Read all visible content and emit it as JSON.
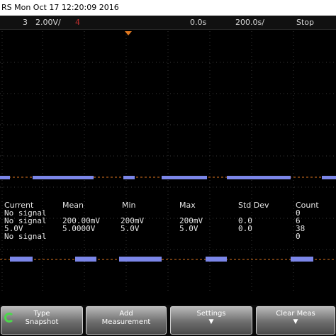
{
  "titlebar": {
    "text": "RS Mon Oct 17 12:20:09 2016"
  },
  "status": {
    "channel": "3",
    "volts_div": "2.00V/",
    "channel4": "4",
    "time_pos": "0.0s",
    "time_div": "200.0s/",
    "run_state": "Stop"
  },
  "colors": {
    "trace": "#7b86e8",
    "grid": "#3a3a3a",
    "trigger": "#e07820",
    "active_icon": "#4bd84b"
  },
  "measurements": {
    "headers": [
      "Current",
      "Mean",
      "Min",
      "Max",
      "Std Dev",
      "Count"
    ],
    "rows": [
      [
        "No signal",
        "",
        "",
        "",
        "",
        "0"
      ],
      [
        "No signal",
        "200.00mV",
        "200mV",
        "200mV",
        "0.0",
        "6"
      ],
      [
        "5.0V",
        "5.0000V",
        "5.0V",
        "5.0V",
        "0.0",
        "38"
      ],
      [
        "No signal",
        "",
        "",
        "",
        "",
        "0"
      ]
    ]
  },
  "softkeys": [
    {
      "line1": "Type",
      "line2": "Snapshot",
      "icon": "cycle-icon"
    },
    {
      "line1": "Add",
      "line2": "Measurement"
    },
    {
      "line1": "Settings",
      "arrow": "down-arrow-icon"
    },
    {
      "line1": "Clear Meas",
      "arrow": "down-arrow-icon"
    }
  ]
}
